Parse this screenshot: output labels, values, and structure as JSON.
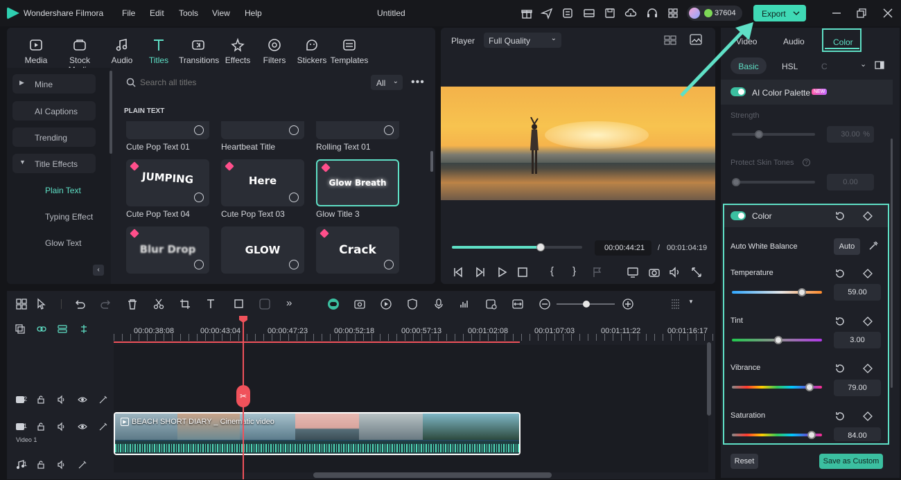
{
  "app": {
    "name": "Wondershare Filmora",
    "title": "Untitled",
    "credits": "37604",
    "export_label": "Export"
  },
  "menu": [
    "File",
    "Edit",
    "Tools",
    "View",
    "Help"
  ],
  "library": {
    "tabs": [
      "Media",
      "Stock Media",
      "Audio",
      "Titles",
      "Transitions",
      "Effects",
      "Filters",
      "Stickers",
      "Templates"
    ],
    "active_tab": "Titles",
    "sidebar": [
      "Mine",
      "AI Captions",
      "Trending",
      "Title Effects",
      "Plain Text",
      "Typing Effect",
      "Glow Text"
    ],
    "search_placeholder": "Search all titles",
    "filter": "All",
    "section": "PLAIN TEXT",
    "cards": [
      {
        "label": "Cute Pop Text 01",
        "text": ""
      },
      {
        "label": "Heartbeat Title",
        "text": ""
      },
      {
        "label": "Rolling Text 01",
        "text": ""
      },
      {
        "label": "Cute Pop Text 04",
        "text": "JUMPING"
      },
      {
        "label": "Cute Pop Text 03",
        "text": "Here"
      },
      {
        "label": "Glow Title 3",
        "text": "Glow Breath"
      },
      {
        "label": "",
        "text": "Blur Drop"
      },
      {
        "label": "",
        "text": "GLOW"
      },
      {
        "label": "",
        "text": "Crack"
      }
    ]
  },
  "player": {
    "label": "Player",
    "quality": "Full Quality",
    "current_time": "00:00:44:21",
    "separator": "/",
    "total_time": "00:01:04:19",
    "progress": 0.68
  },
  "props": {
    "tabs": [
      "Video",
      "Audio",
      "Color"
    ],
    "active_tab": "Color",
    "subtabs": [
      "Basic",
      "HSL",
      "C"
    ],
    "ai_palette": "AI Color Palette",
    "new_badge": "NEW",
    "strength_label": "Strength",
    "strength_value": "30.00",
    "strength_unit": "%",
    "protect_label": "Protect Skin Tones",
    "protect_value": "0.00",
    "color_section": "Color",
    "awb_label": "Auto White Balance",
    "awb_button": "Auto",
    "temperature_label": "Temperature",
    "temperature_value": "59.00",
    "tint_label": "Tint",
    "tint_value": "3.00",
    "vibrance_label": "Vibrance",
    "vibrance_value": "79.00",
    "saturation_label": "Saturation",
    "saturation_value": "84.00",
    "reset_label": "Reset",
    "save_label": "Save as Custom"
  },
  "timeline": {
    "ruler": [
      "00:00:38:08",
      "00:00:43:04",
      "00:00:47:23",
      "00:00:52:18",
      "00:00:57:13",
      "00:01:02:08",
      "00:01:07:03",
      "00:01:11:22",
      "00:01:16:17"
    ],
    "tracks": [
      "2",
      "1",
      "1"
    ],
    "video_track_name": "Video 1",
    "clip_title": "BEACH SHORT DIARY _ Cinematic video"
  },
  "colors": {
    "accent": "#5fe0c6",
    "export": "#3fd9b5",
    "playhead": "#f0525b",
    "bg": "#141519",
    "panel": "#1e2027"
  }
}
